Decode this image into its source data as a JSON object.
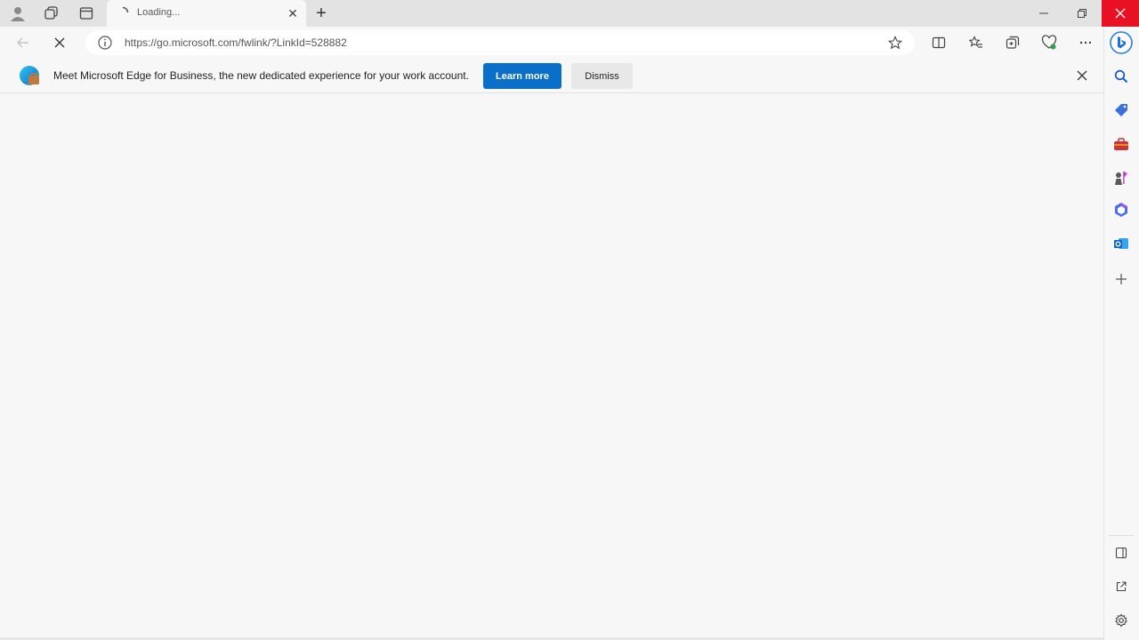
{
  "tab": {
    "title": "Loading..."
  },
  "address_bar": {
    "url": "https://go.microsoft.com/fwlink/?LinkId=528882"
  },
  "infobar": {
    "message": "Meet Microsoft Edge for Business, the new dedicated experience for your work account.",
    "learn_more_label": "Learn more",
    "dismiss_label": "Dismiss"
  },
  "colors": {
    "accent": "#0a6fc9",
    "close": "#e81123"
  },
  "icons": {
    "titlebar": [
      "profile-icon",
      "workspaces-icon",
      "tab-actions-icon"
    ],
    "toolbar": [
      "favorite-star-icon",
      "split-screen-icon",
      "favorites-icon",
      "collections-icon",
      "browser-essentials-icon",
      "more-icon"
    ],
    "sidebar": [
      "bing-copilot-icon",
      "search-icon",
      "shopping-icon",
      "tools-icon",
      "games-icon",
      "microsoft-365-icon",
      "outlook-icon",
      "add-icon",
      "sidebar-toggle-icon",
      "open-external-icon",
      "settings-icon"
    ]
  }
}
